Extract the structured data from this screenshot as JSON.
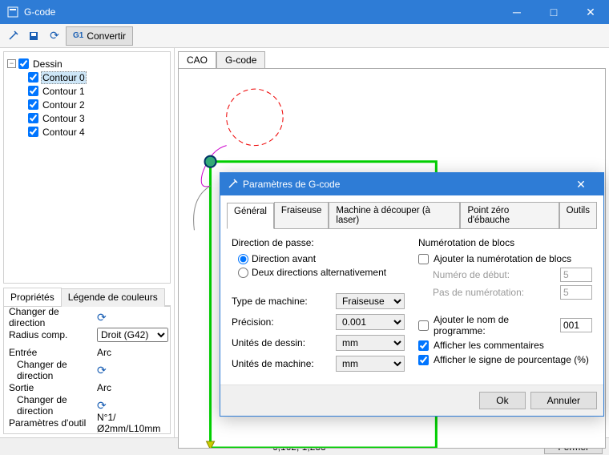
{
  "window": {
    "title": "G-code"
  },
  "toolbar": {
    "convert_label": "Convertir"
  },
  "tree": {
    "root": "Dessin",
    "items": [
      "Contour 0",
      "Contour 1",
      "Contour 2",
      "Contour 3",
      "Contour 4"
    ]
  },
  "props_tabs": [
    "Propriétés",
    "Légende de couleurs"
  ],
  "props": {
    "rows": [
      {
        "k": "Changer de direction",
        "v": "↻",
        "type": "icon"
      },
      {
        "k": "Radius comp.",
        "v": "Droit (G42)",
        "type": "select"
      },
      {
        "k": "Entrée",
        "v": "Arc",
        "type": "text"
      },
      {
        "k": "Changer de direction",
        "v": "↻",
        "type": "icon",
        "indent": true
      },
      {
        "k": "Sortie",
        "v": "Arc",
        "type": "text"
      },
      {
        "k": "Changer de direction",
        "v": "↻",
        "type": "icon",
        "indent": true
      },
      {
        "k": "Paramètres d'outil",
        "v": "N°1/Ø2mm/L10mm",
        "type": "text"
      }
    ]
  },
  "canvas_tabs": [
    "CAO",
    "G-code"
  ],
  "status": {
    "coord": "6,162; 1,233",
    "close": "Fermer"
  },
  "dialog": {
    "title": "Paramètres de G-code",
    "tabs": [
      "Général",
      "Fraiseuse",
      "Machine à découper (à laser)",
      "Point zéro d'ébauche",
      "Outils"
    ],
    "left": {
      "group1": "Direction de passe:",
      "radio1": "Direction avant",
      "radio2": "Deux directions alternativement",
      "fields": [
        {
          "label": "Type de machine:",
          "value": "Fraiseuse"
        },
        {
          "label": "Précision:",
          "value": "0.001"
        },
        {
          "label": "Unités de dessin:",
          "value": "mm"
        },
        {
          "label": "Unités de machine:",
          "value": "mm"
        }
      ]
    },
    "right": {
      "group": "Numérotation de blocs",
      "check1": "Ajouter la numérotation de blocs",
      "row1_label": "Numéro de début:",
      "row1_val": "5",
      "row2_label": "Pas de numérotation:",
      "row2_val": "5",
      "check2": "Ajouter le nom de programme:",
      "prog_val": "001",
      "check3": "Afficher les commentaires",
      "check4": "Afficher le signe de pourcentage (%)"
    },
    "ok": "Ok",
    "cancel": "Annuler"
  }
}
